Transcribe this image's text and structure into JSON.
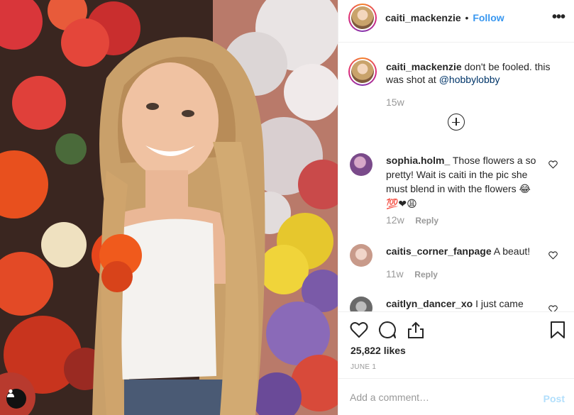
{
  "post": {
    "author": "caiti_mackenzie",
    "dot": "•",
    "follow_label": "Follow",
    "more_label": "•••",
    "caption_text": "don't be fooled. this was shot at",
    "caption_mention": "@hobbylobby",
    "caption_time": "15w",
    "likes": "25,822 likes",
    "date": "JUNE 1",
    "add_comment_placeholder": "Add a comment…",
    "post_label": "Post"
  },
  "comments": [
    {
      "user": "sophia.holm_",
      "text": "Those flowers a so pretty! Wait is caiti in the pic she must blend in with the flowers",
      "emoji_line1": "😂",
      "emoji_line2": "💯❤😩",
      "time": "12w",
      "reply_label": "Reply",
      "avatar_color": "#7a4a8a"
    },
    {
      "user": "caitis_corner_fanpage",
      "text": "A beaut!",
      "time": "11w",
      "reply_label": "Reply",
      "avatar_color": "#c89a8a"
    },
    {
      "user": "caitlyn_dancer_xo",
      "text": "I just came",
      "avatar_color": "#6a6a6a"
    }
  ],
  "icons": {
    "like": "heart-icon",
    "comment": "comment-icon",
    "share": "share-icon",
    "save": "bookmark-icon",
    "user_tags": "user-icon",
    "load_more": "plus-circle-icon"
  },
  "colors": {
    "link_blue": "#3897f0",
    "mention": "#003569",
    "muted": "#999999",
    "post_disabled": "#b2dffc",
    "text": "#262626"
  }
}
